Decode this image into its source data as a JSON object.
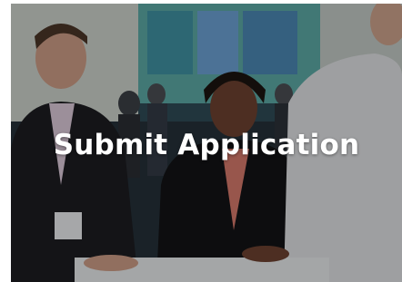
{
  "card": {
    "title": "Submit Application"
  },
  "image": {
    "subject": "conference-attendees-photo"
  }
}
